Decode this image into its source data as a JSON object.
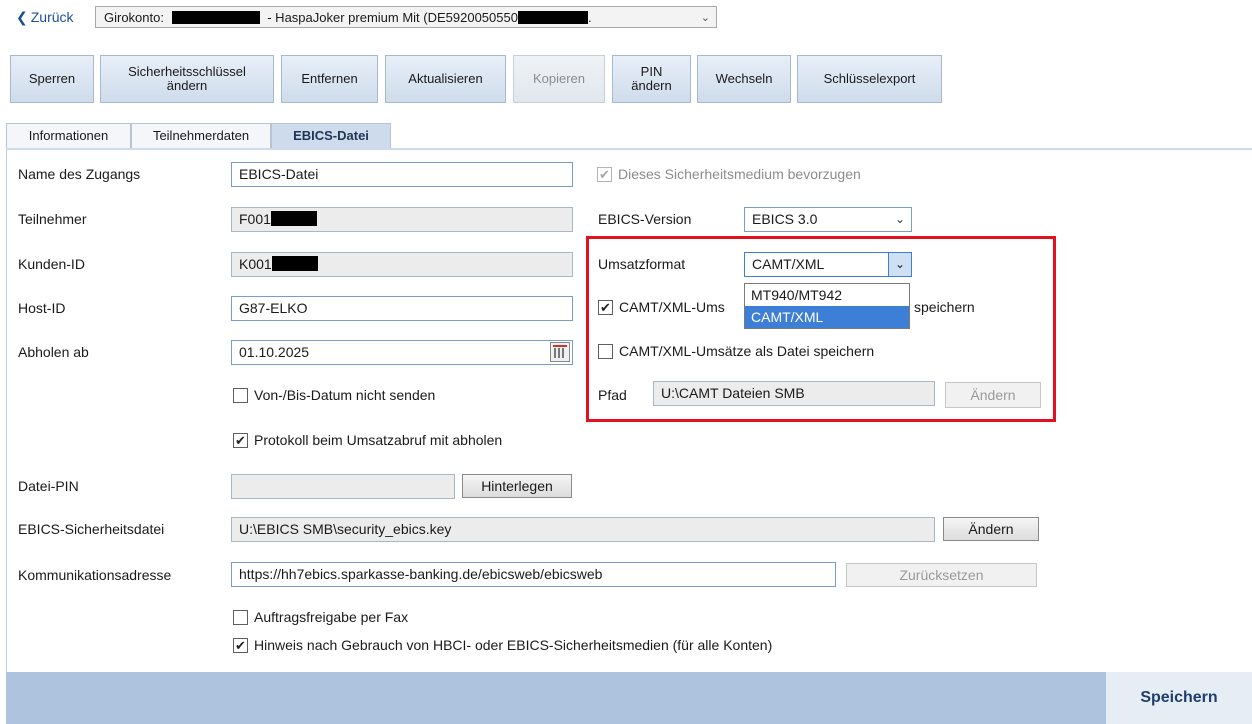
{
  "nav": {
    "back_label": "Zurück"
  },
  "account": {
    "prefix": "Girokonto:",
    "middle": "- HaspaJoker premium Mit (DE5920050550",
    "suffix": "."
  },
  "toolbar": {
    "sperren": "Sperren",
    "schluessel_line1": "Sicherheitsschlüssel",
    "schluessel_line2": "ändern",
    "entfernen": "Entfernen",
    "aktualisieren": "Aktualisieren",
    "kopieren": "Kopieren",
    "pin_line1": "PIN",
    "pin_line2": "ändern",
    "wechseln": "Wechseln",
    "schluesselexport": "Schlüsselexport"
  },
  "tabs": {
    "informationen": "Informationen",
    "teilnehmerdaten": "Teilnehmerdaten",
    "ebics_datei": "EBICS-Datei"
  },
  "form": {
    "name_label": "Name des Zugangs",
    "name_value": "EBICS-Datei",
    "teilnehmer_label": "Teilnehmer",
    "teilnehmer_value": "F001",
    "kunden_label": "Kunden-ID",
    "kunden_value": "K001",
    "host_label": "Host-ID",
    "host_value": "G87-ELKO",
    "abholen_label": "Abholen ab",
    "abholen_value": "01.10.2025",
    "von_bis_label": "Von-/Bis-Datum nicht senden",
    "protokoll_label": "Protokoll beim Umsatzabruf mit abholen",
    "datei_pin_label": "Datei-PIN",
    "datei_pin_value": "",
    "hinterlegen": "Hinterlegen",
    "sicherheitsdatei_label": "EBICS-Sicherheitsdatei",
    "sicherheitsdatei_value": "U:\\EBICS SMB\\security_ebics.key",
    "aendern": "Ändern",
    "kommunikation_label": "Kommunikationsadresse",
    "kommunikation_value": "https://hh7ebics.sparkasse-banking.de/ebicsweb/ebicsweb",
    "zuruecksetzen": "Zurücksetzen",
    "fax_label": "Auftragsfreigabe per Fax",
    "hinweis_label": "Hinweis nach Gebrauch von HBCI- oder EBICS-Sicherheitsmedien (für alle Konten)"
  },
  "right": {
    "bevorzugen_label": "Dieses Sicherheitsmedium bevorzugen",
    "ebics_version_label": "EBICS-Version",
    "ebics_version_value": "EBICS 3.0",
    "umsatzformat_label": "Umsatzformat",
    "umsatzformat_value": "CAMT/XML",
    "umsatzformat_options": [
      "MT940/MT942",
      "CAMT/XML"
    ],
    "camt_speichern_part1": "CAMT/XML-Ums",
    "camt_speichern_part2": "speichern",
    "camt_datei_label": "CAMT/XML-Umsätze als Datei speichern",
    "pfad_label": "Pfad",
    "pfad_value": "U:\\CAMT Dateien SMB",
    "pfad_aendern": "Ändern"
  },
  "footer": {
    "speichern": "Speichern"
  },
  "colors": {
    "highlight": "#e1111f",
    "selection": "#3d7ed6",
    "footer": "#aec3dd"
  }
}
